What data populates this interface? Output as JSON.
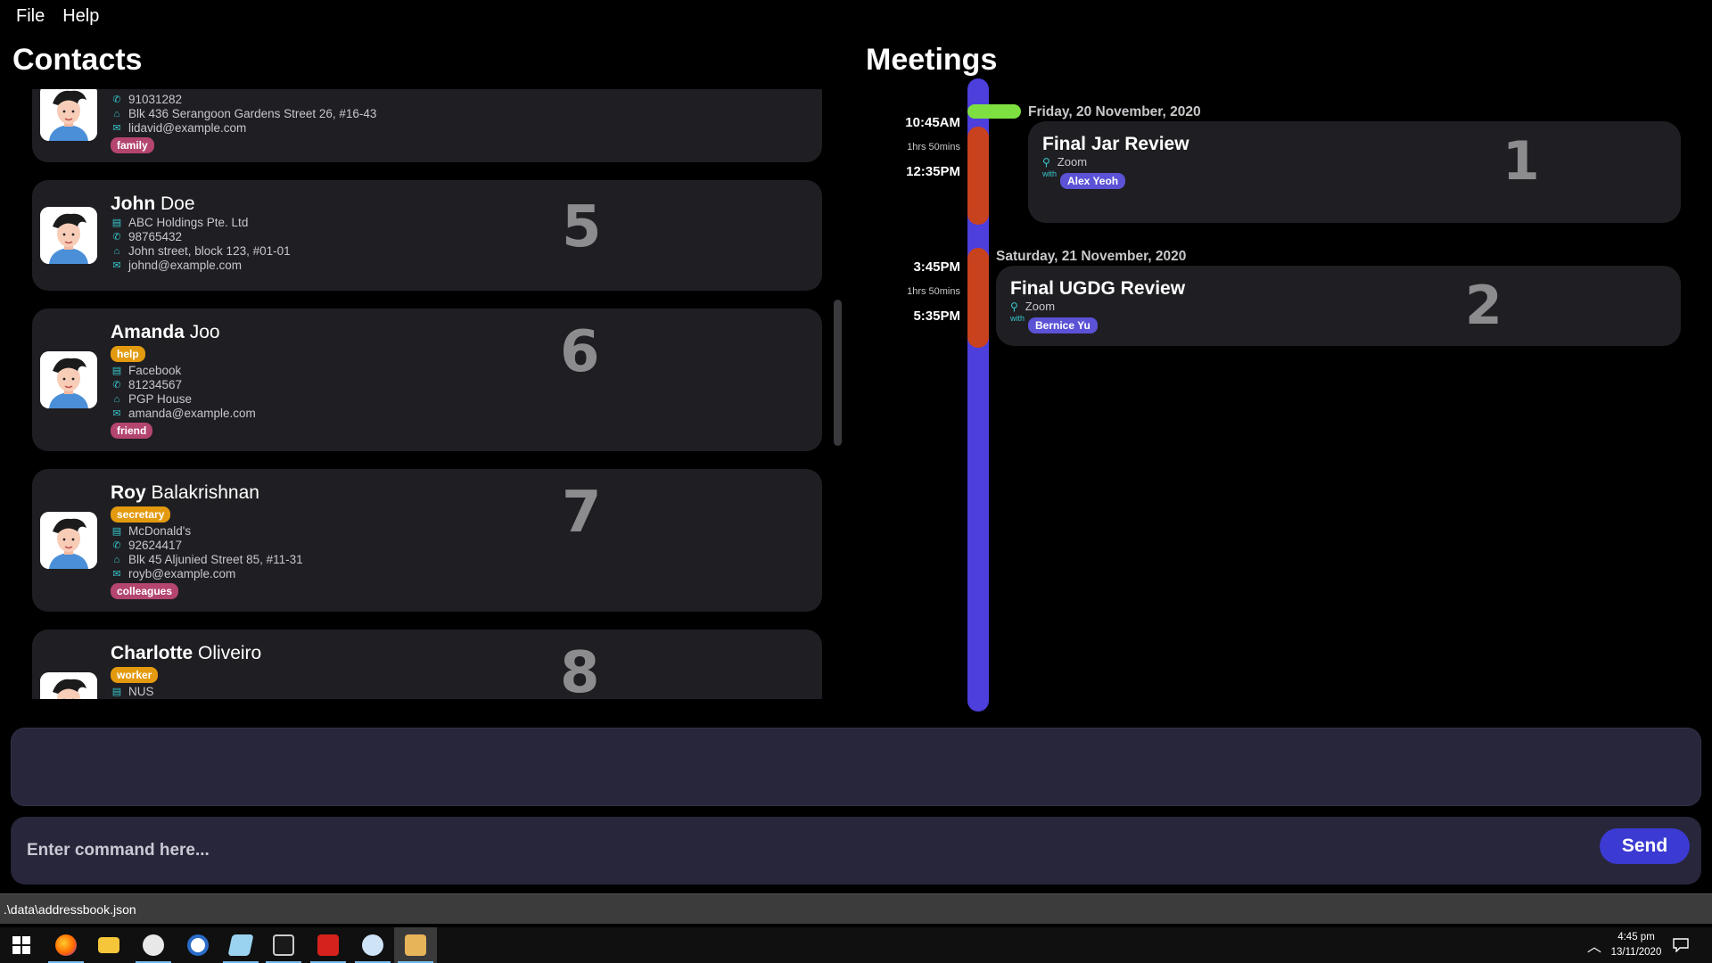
{
  "menu": {
    "file": "File",
    "help": "Help"
  },
  "contacts": {
    "title": "Contacts",
    "partial_top": {
      "phone": "91031282",
      "address": "Blk 436 Serangoon Gardens Street 26, #16-43",
      "email": "lidavid@example.com",
      "tag": "family"
    },
    "items": [
      {
        "first": "John",
        "last": "Doe",
        "role": "",
        "company": "ABC Holdings Pte. Ltd",
        "phone": "98765432",
        "address": "John street, block 123, #01-01",
        "email": "johnd@example.com",
        "tag": "",
        "index": "5"
      },
      {
        "first": "Amanda",
        "last": "Joo",
        "role": "help",
        "company": "Facebook",
        "phone": "81234567",
        "address": "PGP House",
        "email": "amanda@example.com",
        "tag": "friend",
        "index": "6"
      },
      {
        "first": "Roy",
        "last": "Balakrishnan",
        "role": "secretary",
        "company": "McDonald's",
        "phone": "92624417",
        "address": "Blk 45 Aljunied Street 85, #11-31",
        "email": "royb@example.com",
        "tag": "colleagues",
        "index": "7"
      },
      {
        "first": "Charlotte",
        "last": "Oliveiro",
        "role": "worker",
        "company": "NUS",
        "index": "8"
      }
    ]
  },
  "meetings": {
    "title": "Meetings",
    "items": [
      {
        "date": "Friday, 20 November, 2020",
        "start": "10:45AM",
        "duration": "1hrs 50mins",
        "end": "12:35PM",
        "title": "Final Jar Review",
        "location": "Zoom",
        "with_label": "with",
        "person": "Alex Yeoh",
        "index": "1"
      },
      {
        "date": "Saturday, 21 November, 2020",
        "start": "3:45PM",
        "duration": "1hrs 50mins",
        "end": "5:35PM",
        "title": "Final UGDG Review",
        "location": "Zoom",
        "with_label": "with",
        "person": "Bernice Yu",
        "index": "2"
      }
    ]
  },
  "command": {
    "placeholder": "Enter command here...",
    "send": "Send"
  },
  "status": {
    "path": ".\\data\\addressbook.json"
  },
  "taskbar": {
    "time": "4:45 pm",
    "date": "13/11/2020"
  },
  "colors": {
    "background": "#000000",
    "card": "#1f1e22",
    "accent": "#3b3ad2",
    "timeline": "#4c3fdc",
    "meeting_segment": "#c9421e",
    "now_marker": "#7ee040",
    "tag_pink": "#b3456f",
    "tag_orange": "#e39a0e"
  }
}
